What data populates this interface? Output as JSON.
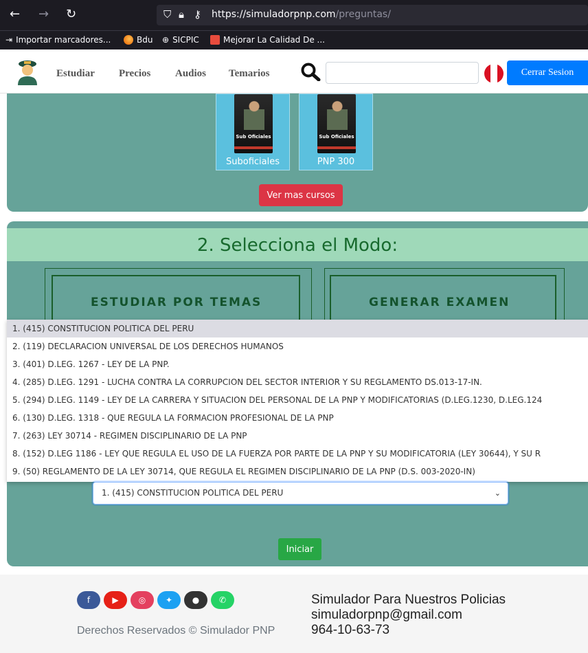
{
  "browser": {
    "url_host": "https://simuladorpnp.com",
    "url_path": "/preguntas/",
    "bookmarks": [
      {
        "label": "Importar marcadores...",
        "icon": "import-icon"
      },
      {
        "label": "Bdu",
        "icon": "firefox-icon"
      },
      {
        "label": "SICPIC",
        "icon": "globe-icon"
      },
      {
        "label": "Mejorar La Calidad De ...",
        "icon": "site-icon"
      }
    ]
  },
  "nav": {
    "links": [
      "Estudiar",
      "Precios",
      "Audios",
      "Temarios"
    ],
    "search_placeholder": "",
    "logout_label": "Cerrar Sesion",
    "colors": {
      "flag_red": "#d91023",
      "primary": "#007bff"
    }
  },
  "courses": {
    "items": [
      {
        "label": "Suboficiales",
        "cover_text": "Sub Oficiales"
      },
      {
        "label": "PNP 300",
        "cover_text": "Sub Oficiales"
      }
    ],
    "more_label": "Ver mas cursos"
  },
  "mode": {
    "title": "2. Selecciona el Modo:",
    "options": [
      "ESTUDIAR POR TEMAS",
      "GENERAR EXAMEN"
    ]
  },
  "topics": {
    "items": [
      "1. (415) CONSTITUCION POLITICA DEL PERU",
      "2. (119) DECLARACION UNIVERSAL DE LOS DERECHOS HUMANOS",
      "3. (401) D.LEG. 1267 - LEY DE LA PNP.",
      "4. (285) D.LEG. 1291 - LUCHA CONTRA LA CORRUPCION DEL SECTOR INTERIOR Y SU REGLAMENTO DS.013-17-IN.",
      "5. (294) D.LEG. 1149 - LEY DE LA CARRERA Y SITUACION DEL PERSONAL DE LA PNP Y MODIFICATORIAS (D.LEG.1230, D.LEG.124",
      "6. (130) D.LEG. 1318 - QUE REGULA LA FORMACION PROFESIONAL DE LA PNP",
      "7. (263) LEY 30714 - REGIMEN DISCIPLINARIO DE LA PNP",
      "8. (152) D.LEG 1186 - LEY QUE REGULA EL USO DE LA FUERZA POR PARTE DE LA PNP Y SU MODIFICATORIA (LEY 30644), Y SU R",
      "9. (50) REGLAMENTO DE LA LEY 30714, QUE REGULA EL REGIMEN DISCIPLINARIO DE LA PNP (D.S. 003-2020-IN)"
    ],
    "selected_index": 0,
    "selected_value": "1. (415) CONSTITUCION POLITICA DEL PERU",
    "start_label": "Iniciar"
  },
  "footer": {
    "social": [
      {
        "icon": "facebook-icon",
        "color": "#3b5998"
      },
      {
        "icon": "youtube-icon",
        "color": "#e62117"
      },
      {
        "icon": "instagram-icon",
        "color": "#e4405f"
      },
      {
        "icon": "twitter-icon",
        "color": "#1da1f2"
      },
      {
        "icon": "github-icon",
        "color": "#333333"
      },
      {
        "icon": "whatsapp-icon",
        "color": "#25d366"
      }
    ],
    "rights": "Derechos Reservados © Simulador PNP",
    "site_name": "Simulador Para Nuestros Policias",
    "email": "simuladorpnp@gmail.com",
    "phone": "964-10-63-73"
  }
}
